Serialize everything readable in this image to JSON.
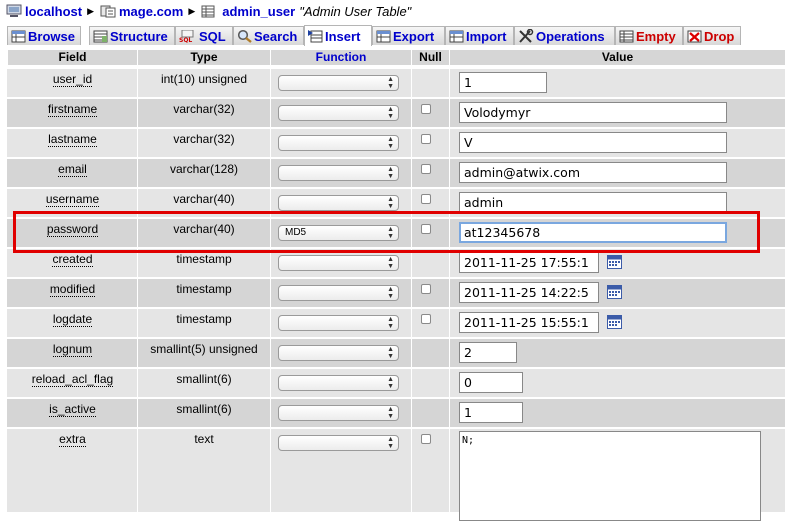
{
  "breadcrumb": {
    "server": "localhost",
    "database": "mage.com",
    "table": "admin_user",
    "table_comment": "\"Admin User Table\""
  },
  "tabs": [
    {
      "label": "Browse",
      "icon": "browse-icon",
      "active": false
    },
    {
      "label": "Structure",
      "icon": "structure-icon",
      "active": false
    },
    {
      "label": "SQL",
      "icon": "sql-icon",
      "active": false
    },
    {
      "label": "Search",
      "icon": "search-icon",
      "active": false
    },
    {
      "label": "Insert",
      "icon": "insert-icon",
      "active": true
    },
    {
      "label": "Export",
      "icon": "export-icon",
      "active": false
    },
    {
      "label": "Import",
      "icon": "import-icon",
      "active": false
    },
    {
      "label": "Operations",
      "icon": "operations-icon",
      "active": false
    },
    {
      "label": "Empty",
      "icon": "empty-icon",
      "active": false
    },
    {
      "label": "Drop",
      "icon": "drop-icon",
      "active": false
    }
  ],
  "columns": {
    "field": "Field",
    "type": "Type",
    "function": "Function",
    "null": "Null",
    "value": "Value"
  },
  "rows": [
    {
      "field": "user_id",
      "type": "int(10) unsigned",
      "function": "",
      "nullable": false,
      "value": "1"
    },
    {
      "field": "firstname",
      "type": "varchar(32)",
      "function": "",
      "nullable": true,
      "value": "Volodymyr"
    },
    {
      "field": "lastname",
      "type": "varchar(32)",
      "function": "",
      "nullable": true,
      "value": "V"
    },
    {
      "field": "email",
      "type": "varchar(128)",
      "function": "",
      "nullable": true,
      "value": "admin@atwix.com"
    },
    {
      "field": "username",
      "type": "varchar(40)",
      "function": "",
      "nullable": true,
      "value": "admin"
    },
    {
      "field": "password",
      "type": "varchar(40)",
      "function": "MD5",
      "nullable": true,
      "value": "at12345678"
    },
    {
      "field": "created",
      "type": "timestamp",
      "function": "",
      "nullable": false,
      "value": "2011-11-25 17:55:1"
    },
    {
      "field": "modified",
      "type": "timestamp",
      "function": "",
      "nullable": true,
      "value": "2011-11-25 14:22:5"
    },
    {
      "field": "logdate",
      "type": "timestamp",
      "function": "",
      "nullable": true,
      "value": "2011-11-25 15:55:1"
    },
    {
      "field": "lognum",
      "type": "smallint(5) unsigned",
      "function": "",
      "nullable": false,
      "value": "2"
    },
    {
      "field": "reload_acl_flag",
      "type": "smallint(6)",
      "function": "",
      "nullable": false,
      "value": "0"
    },
    {
      "field": "is_active",
      "type": "smallint(6)",
      "function": "",
      "nullable": false,
      "value": "1"
    },
    {
      "field": "extra",
      "type": "text",
      "function": "",
      "nullable": true,
      "value": "N;"
    }
  ],
  "colors": {
    "highlight": "#e00000",
    "link": "#0000cc",
    "danger": "#cc0000",
    "row_odd": "#e5e5e5",
    "row_even": "#d5d5d5"
  }
}
